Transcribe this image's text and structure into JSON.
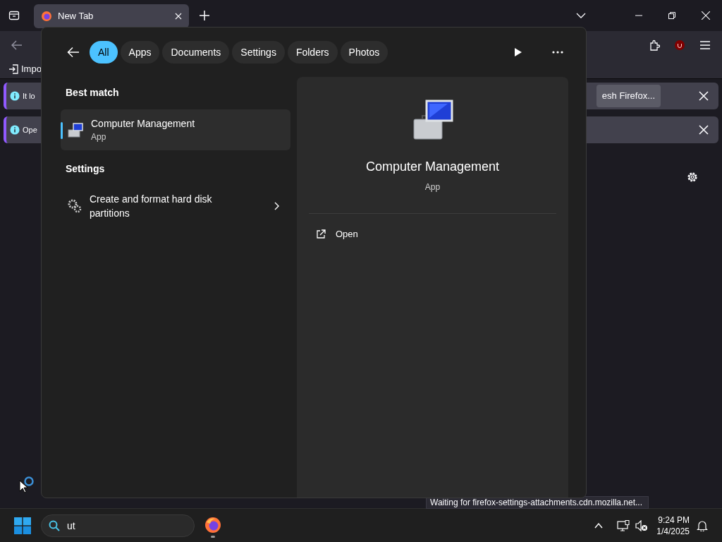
{
  "browser": {
    "tab": {
      "title": "New Tab"
    },
    "bookmark_fragment": "Impo",
    "notifications": [
      {
        "text": "It lo",
        "button": "esh Firefox..."
      },
      {
        "text": "Ope"
      }
    ]
  },
  "search_panel": {
    "filters": [
      {
        "label": "All",
        "selected": true
      },
      {
        "label": "Apps",
        "selected": false
      },
      {
        "label": "Documents",
        "selected": false
      },
      {
        "label": "Settings",
        "selected": false
      },
      {
        "label": "Folders",
        "selected": false
      },
      {
        "label": "Photos",
        "selected": false
      }
    ],
    "sections": [
      {
        "heading": "Best match",
        "items": [
          {
            "kind": "app",
            "title": "Computer Management",
            "subtitle": "App",
            "selected": true
          }
        ]
      },
      {
        "heading": "Settings",
        "items": [
          {
            "kind": "setting",
            "title": "Create and format hard disk partitions",
            "selected": false
          }
        ]
      }
    ],
    "preview": {
      "title": "Computer Management",
      "subtitle": "App",
      "actions": [
        {
          "label": "Open"
        }
      ]
    }
  },
  "status_text": "Waiting for firefox-settings-attachments.cdn.mozilla.net...",
  "taskbar": {
    "search_value": "ut",
    "time": "9:24 PM",
    "date": "1/4/2025"
  }
}
